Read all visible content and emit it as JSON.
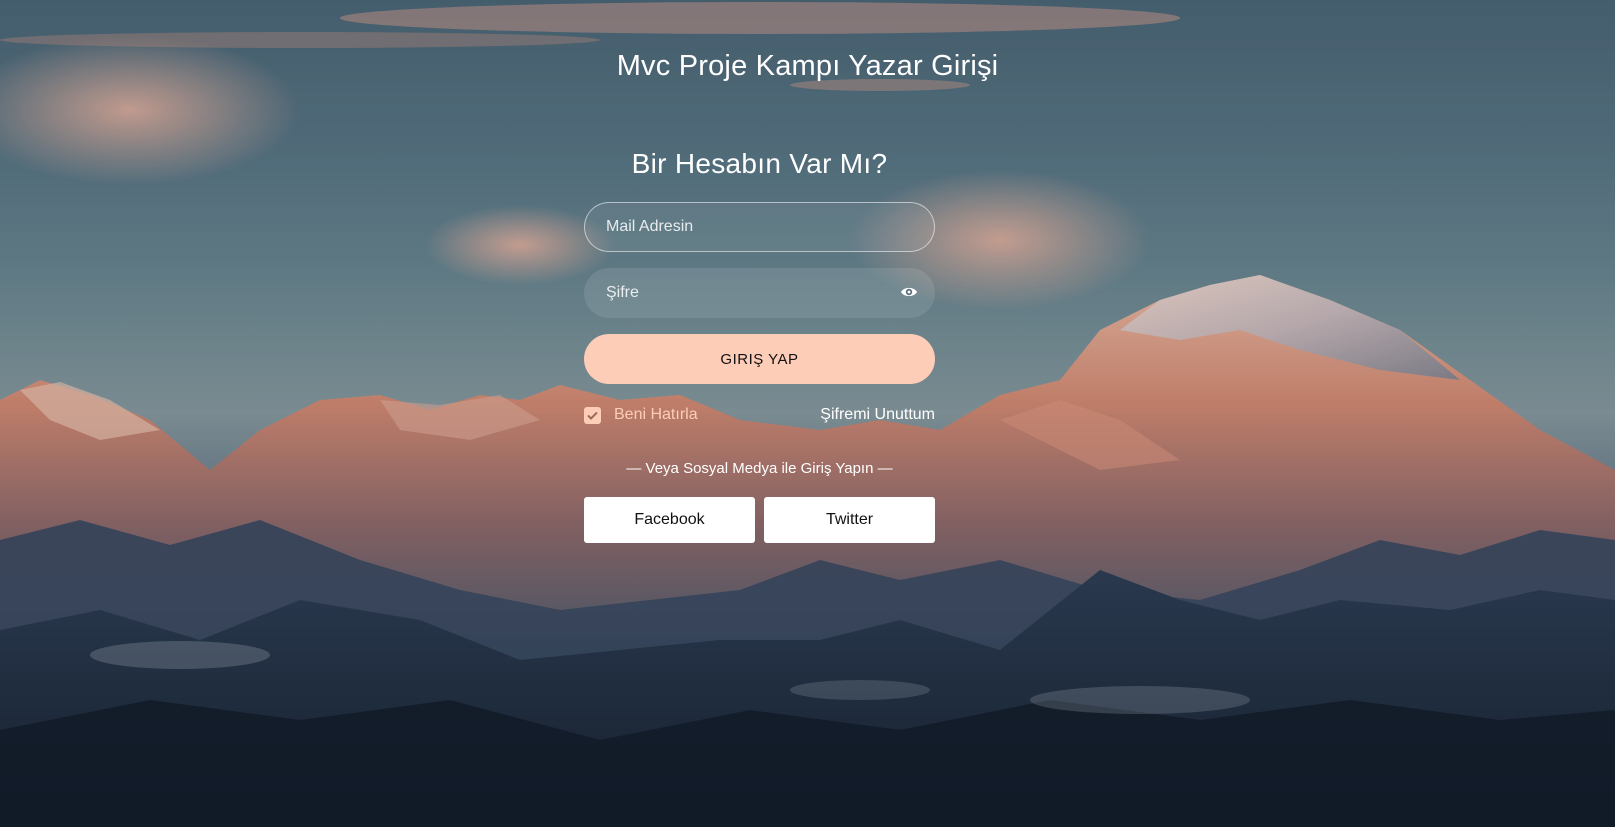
{
  "page": {
    "title": "Mvc Proje Kampı Yazar Girişi"
  },
  "login": {
    "heading": "Bir Hesabın Var Mı?",
    "email_placeholder": "Mail Adresin",
    "password_placeholder": "Şifre",
    "submit_label": "GIRIŞ YAP",
    "remember_label": "Beni Hatırla",
    "remember_checked": true,
    "forgot_label": "Şifremi Unuttum",
    "social_divider": "— Veya Sosyal Medya ile Giriş Yapın —",
    "social": {
      "facebook_label": "Facebook",
      "twitter_label": "Twitter"
    }
  },
  "icons": {
    "password_toggle": "eye-icon",
    "checkbox_mark": "check-icon"
  },
  "colors": {
    "accent": "#fdcdb7",
    "button_text": "#111111",
    "social_button_bg": "#ffffff"
  }
}
